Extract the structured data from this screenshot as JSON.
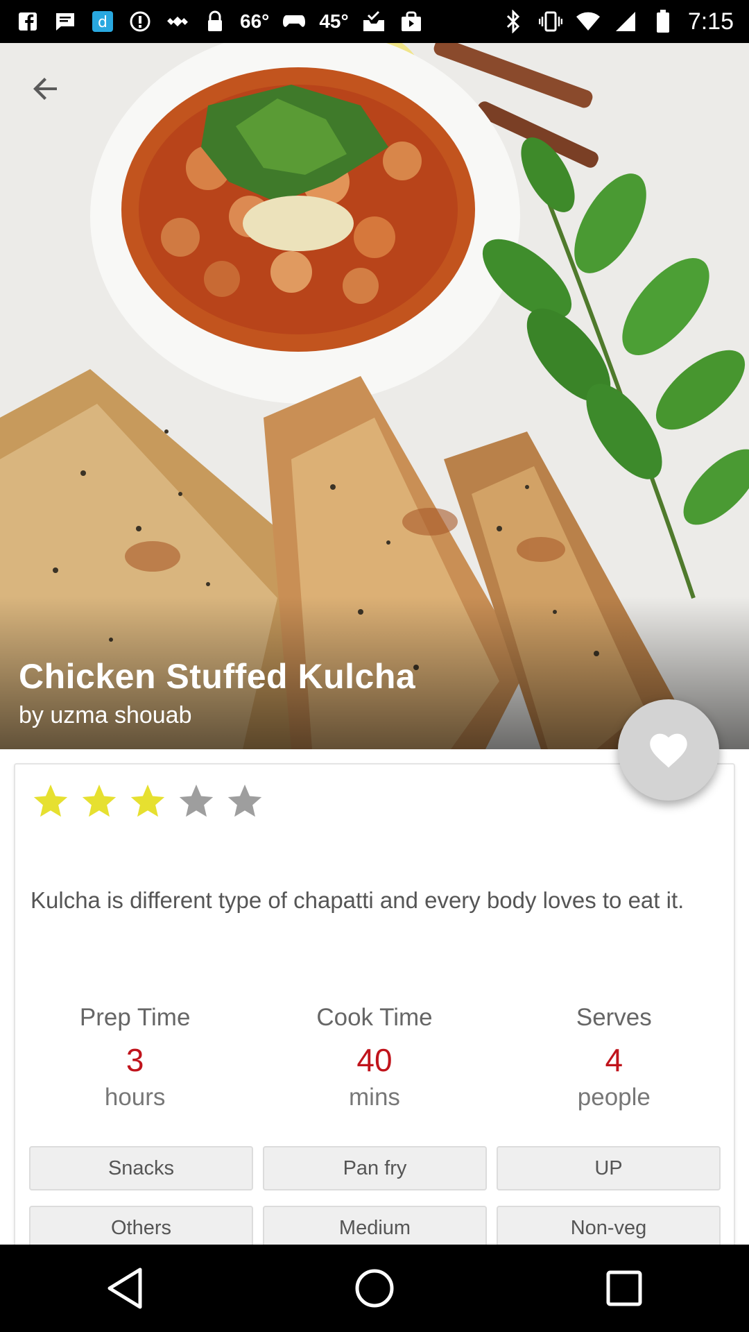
{
  "status_bar": {
    "temp_1": "66°",
    "temp_2": "45°",
    "time": "7:15",
    "icons_left": [
      "facebook-icon",
      "message-icon",
      "dictionary-app-icon",
      "info-icon",
      "fake-gps-icon",
      "lock-icon",
      "temp-66",
      "game-controller-icon",
      "temp-45",
      "inbox-check-icon",
      "shopping-bag-icon"
    ],
    "icons_right": [
      "bluetooth-icon",
      "vibrate-icon",
      "wifi-icon",
      "signal-icon",
      "battery-icon"
    ]
  },
  "hero": {
    "back_icon": "arrow-back-icon",
    "title": "Chicken Stuffed Kulcha",
    "author": "by uzma shouab"
  },
  "favorite": {
    "icon": "heart-icon"
  },
  "rating": {
    "value": 3,
    "max": 5,
    "filled_color": "#e6e030",
    "empty_color": "#9e9e9e"
  },
  "description": "Kulcha is different type of chapatti and every body loves to eat it.",
  "stats": {
    "prep": {
      "label": "Prep Time",
      "value": "3",
      "unit": "hours"
    },
    "cook": {
      "label": "Cook Time",
      "value": "40",
      "unit": "mins"
    },
    "serves": {
      "label": "Serves",
      "value": "4",
      "unit": "people"
    }
  },
  "tags": [
    "Snacks",
    "Pan fry",
    "UP",
    "Others",
    "Medium",
    "Non-veg"
  ],
  "nav": {
    "back": "nav-back-icon",
    "home": "nav-home-icon",
    "recents": "nav-recents-icon"
  },
  "colors": {
    "accent": "#c0141c"
  }
}
